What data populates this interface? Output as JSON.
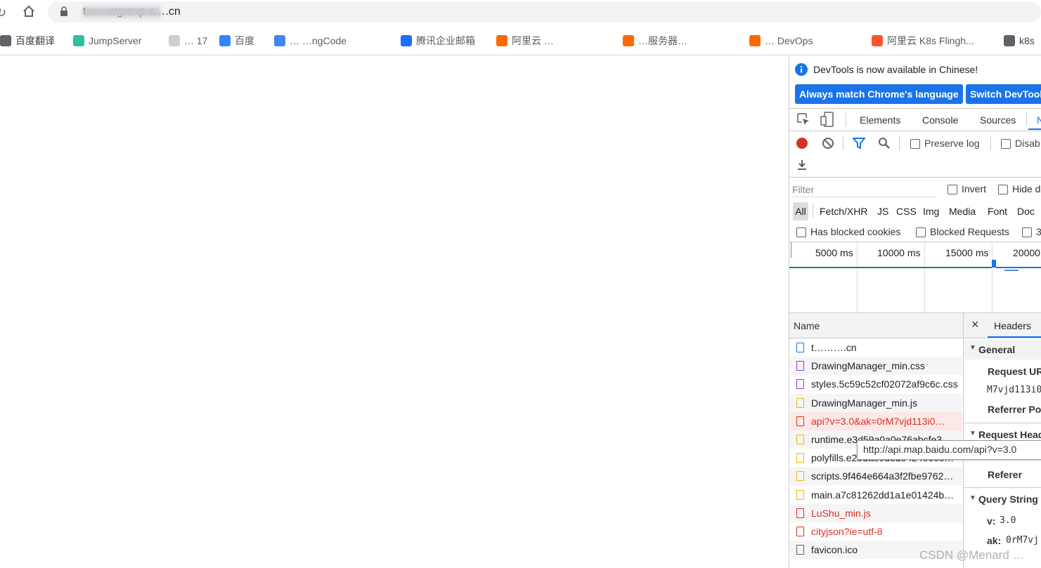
{
  "browser": {
    "url": "t……wgroup.c….cn",
    "bookmarks": [
      {
        "label": "百度翻译",
        "icon": "globe-icon",
        "color": "#5f6368"
      },
      {
        "label": "JumpServer",
        "icon": "jumpserver-icon",
        "color": "#2fbfa0"
      },
      {
        "label": "… 17",
        "icon": "folder-icon",
        "color": "#cfcfcf"
      },
      {
        "label": "百度",
        "icon": "baidu-icon",
        "color": "#3385ff"
      },
      {
        "label": "… …ngCode",
        "icon": "code-icon",
        "color": "#4285f4"
      },
      {
        "label": "腾讯企业邮箱",
        "icon": "tencent-icon",
        "color": "#1e6fff"
      },
      {
        "label": "阿里云 …",
        "icon": "aliyun-icon",
        "color": "#ff6a00"
      },
      {
        "label": "…服务器…",
        "icon": "aliyun-icon",
        "color": "#ff6a00"
      },
      {
        "label": "… DevOps",
        "icon": "aliyun-icon",
        "color": "#ff6a00"
      },
      {
        "label": "阿里云 K8s Flingh...",
        "icon": "csdn-icon",
        "color": "#fc5531"
      },
      {
        "label": "k8s",
        "icon": "k8s-icon",
        "color": "#5f6368"
      }
    ]
  },
  "devtools": {
    "info_banner": "DevTools is now available in Chinese!",
    "btn_match_language": "Always match Chrome's language",
    "btn_switch": "Switch DevTools",
    "tabs": [
      "Elements",
      "Console",
      "Sources",
      "N"
    ],
    "preserve_log": "Preserve log",
    "disable_cache": "Disab",
    "filter_placeholder": "Filter",
    "invert": "Invert",
    "hide": "Hide d",
    "type_filters": [
      "All",
      "Fetch/XHR",
      "JS",
      "CSS",
      "Img",
      "Media",
      "Font",
      "Doc"
    ],
    "has_blocked_cookies": "Has blocked cookies",
    "blocked_requests": "Blocked Requests",
    "third_party": "3",
    "timeline_ticks": [
      "5000 ms",
      "10000 ms",
      "15000 ms",
      "20000"
    ],
    "name_header": "Name",
    "requests": [
      {
        "name": "t……….cn",
        "icon": "document-icon",
        "icon_color": "#1a73e8",
        "status": "normal"
      },
      {
        "name": "DrawingManager_min.css",
        "icon": "css-file-icon",
        "icon_color": "#9334e6",
        "status": "normal"
      },
      {
        "name": "styles.5c59c52cf02072af9c6c.css",
        "icon": "css-file-icon",
        "icon_color": "#9334e6",
        "status": "normal"
      },
      {
        "name": "DrawingManager_min.js",
        "icon": "js-file-icon",
        "icon_color": "#f4b400",
        "status": "normal"
      },
      {
        "name": "api?v=3.0&ak=0rM7vjd113i0…",
        "icon": "js-file-icon",
        "icon_color": "#d93025",
        "status": "selected"
      },
      {
        "name": "runtime.e3d59a0a0e76abcfe3…",
        "icon": "js-file-icon",
        "icon_color": "#f4b400",
        "status": "normal"
      },
      {
        "name": "polyfills.e29dae0ded0424000c…",
        "icon": "js-file-icon",
        "icon_color": "#f4b400",
        "status": "normal"
      },
      {
        "name": "scripts.9f464e664a3f2fbe9762…",
        "icon": "js-file-icon",
        "icon_color": "#f4b400",
        "status": "normal"
      },
      {
        "name": "main.a7c81262dd1a1e01424b…",
        "icon": "js-file-icon",
        "icon_color": "#f4b400",
        "status": "normal"
      },
      {
        "name": "LuShu_min.js",
        "icon": "js-file-icon",
        "icon_color": "#d93025",
        "status": "error"
      },
      {
        "name": "cityjson?ie=utf-8",
        "icon": "js-file-icon",
        "icon_color": "#d93025",
        "status": "error"
      },
      {
        "name": "favicon.ico",
        "icon": "image-file-icon",
        "icon_color": "#5f6368",
        "status": "normal"
      }
    ],
    "tooltip": "http://api.map.baidu.com/api?v=3.0",
    "detail": {
      "close": "×",
      "tab_headers": "Headers",
      "general": "General",
      "request_url_label": "Request UR",
      "request_url_value": "M7vjd113i0",
      "referrer_policy_label": "Referrer Po",
      "request_headers": "Request Head",
      "referer_label": "Referer",
      "query_string": "Query String",
      "v_label": "v:",
      "v_value": "3.0",
      "ak_label": "ak:",
      "ak_value": "0rM7vj"
    }
  },
  "watermark": "CSDN @Menard …"
}
